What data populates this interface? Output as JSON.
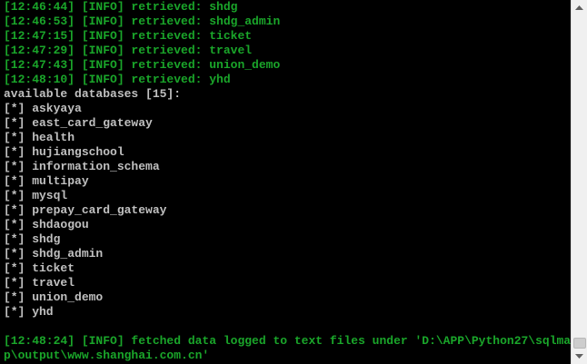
{
  "console": {
    "log_lines": [
      "[12:46:44] [INFO] retrieved: shdg",
      "[12:46:53] [INFO] retrieved: shdg_admin",
      "[12:47:15] [INFO] retrieved: ticket",
      "[12:47:29] [INFO] retrieved: travel",
      "[12:47:43] [INFO] retrieved: union_demo",
      "[12:48:10] [INFO] retrieved: yhd"
    ],
    "databases_header": "available databases [15]:",
    "databases": [
      "[*] askyaya",
      "[*] east_card_gateway",
      "[*] health",
      "[*] hujiangschool",
      "[*] information_schema",
      "[*] multipay",
      "[*] mysql",
      "[*] prepay_card_gateway",
      "[*] shdaogou",
      "[*] shdg",
      "[*] shdg_admin",
      "[*] ticket",
      "[*] travel",
      "[*] union_demo",
      "[*] yhd"
    ],
    "footer_line_1": "[12:48:24] [INFO] fetched data logged to text files under 'D:\\APP\\Python27\\sqlma",
    "footer_line_2": "p\\output\\www.shanghai.com.cn'"
  },
  "colors": {
    "info_text": "#1aa62a",
    "plain_text": "#c0c0c0",
    "background": "#000000"
  }
}
